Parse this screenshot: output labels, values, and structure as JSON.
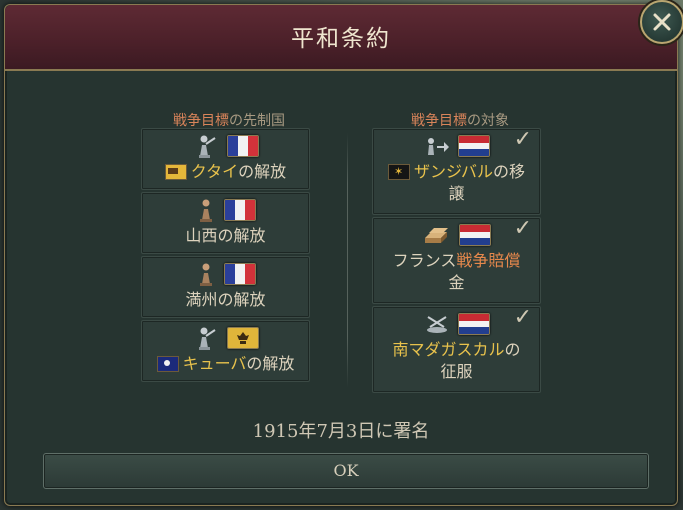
{
  "title": "平和条約",
  "close_label": "×",
  "left_column": {
    "header_strong": "戦争目標",
    "header_weak": "の先制国",
    "cards": [
      {
        "pre": "",
        "highlight": "クタイ",
        "post": "の解放",
        "flag_main": "fr",
        "figure": "pawn-pointing",
        "mini_flag": "kutai"
      },
      {
        "pre": "山西の解放",
        "highlight": "",
        "post": "",
        "flag_main": "fr",
        "figure": "pawn",
        "mini_flag": ""
      },
      {
        "pre": "満州の解放",
        "highlight": "",
        "post": "",
        "flag_main": "fr",
        "figure": "pawn",
        "mini_flag": ""
      },
      {
        "pre": "",
        "highlight": "キューバ",
        "post": "の解放",
        "flag_main": "gold",
        "figure": "pawn-pointing",
        "mini_flag": "cuba"
      }
    ]
  },
  "right_column": {
    "header_strong": "戦争目標",
    "header_weak": "の対象",
    "cards": [
      {
        "line1_highlight": "ザンジバル",
        "line1_rest": "の移",
        "line2": "譲",
        "icon": "transfer-icon",
        "check": "✓",
        "mini_flag": "zanzibar"
      },
      {
        "line1_pre": "フランス",
        "line1_red": "戦争賠償",
        "line2": "金",
        "icon": "reparations-icon",
        "check": "✓"
      },
      {
        "line1_highlight": "南マダガスカル",
        "line1_rest": "の",
        "line2": "征服",
        "icon": "conquest-icon",
        "check": "✓"
      }
    ]
  },
  "signed_text": "1915年7月3日に署名",
  "ok_label": "OK",
  "colors": {
    "header_bg": "#4b2029",
    "panel_bg": "#263430",
    "highlight": "#e8c24c",
    "accent_red": "#e6884c",
    "border_gold": "#8a7a52"
  }
}
